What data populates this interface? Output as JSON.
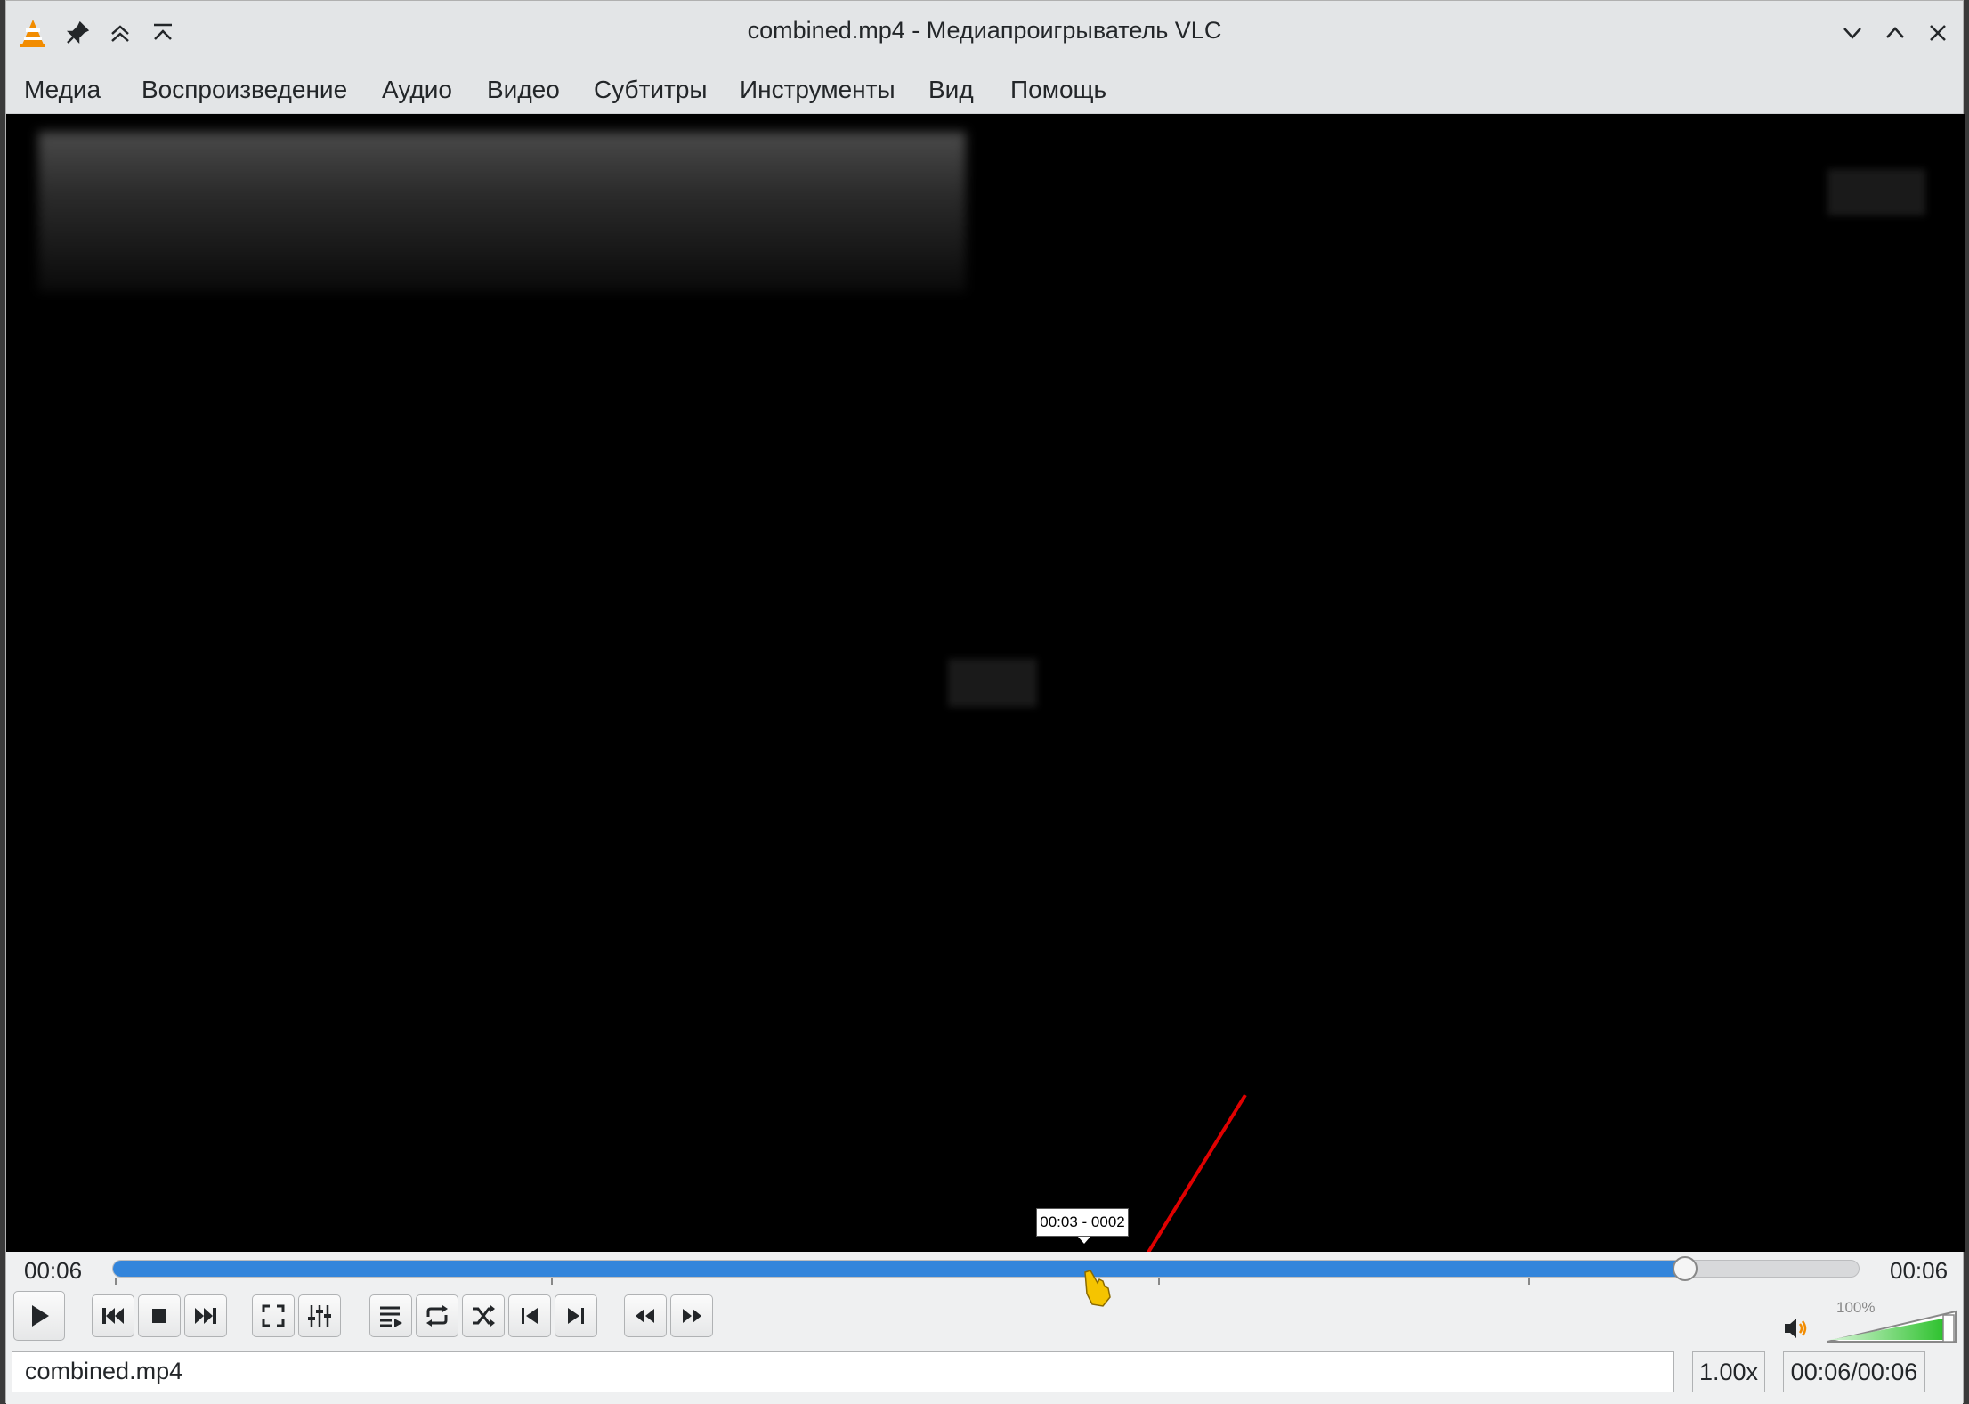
{
  "window": {
    "title": "combined.mp4 - Медиапроигрыватель VLC"
  },
  "menu": {
    "items": [
      "Медиа",
      "Воспроизведение",
      "Аудио",
      "Видео",
      "Субтитры",
      "Инструменты",
      "Вид",
      "Помощь"
    ]
  },
  "seek": {
    "elapsed": "00:06",
    "remaining": "00:06",
    "progress_fraction": 0.9,
    "tooltip": "00:03 - 0002"
  },
  "volume": {
    "label": "100%",
    "level_fraction": 1.0
  },
  "status": {
    "filename": "combined.mp4",
    "speed": "1.00x",
    "duration": "00:06/00:06"
  },
  "colors": {
    "accent": "#3385db",
    "vlc_orange": "#f28c00",
    "volume_green": "#3cc63c",
    "annotation_red": "#e00000"
  },
  "icons": {
    "titlebar_left": [
      "vlc-cone-icon",
      "pin-icon",
      "keep-above-icon",
      "keep-below-icon"
    ],
    "titlebar_right": [
      "minimize-icon",
      "maximize-icon",
      "close-icon"
    ],
    "controls": [
      "play-icon",
      "previous-icon",
      "stop-icon",
      "next-icon",
      "fullscreen-icon",
      "extended-settings-icon",
      "playlist-icon",
      "loop-icon",
      "shuffle-icon",
      "frame-back-icon",
      "frame-next-icon",
      "slower-icon",
      "faster-icon",
      "speaker-icon"
    ]
  }
}
